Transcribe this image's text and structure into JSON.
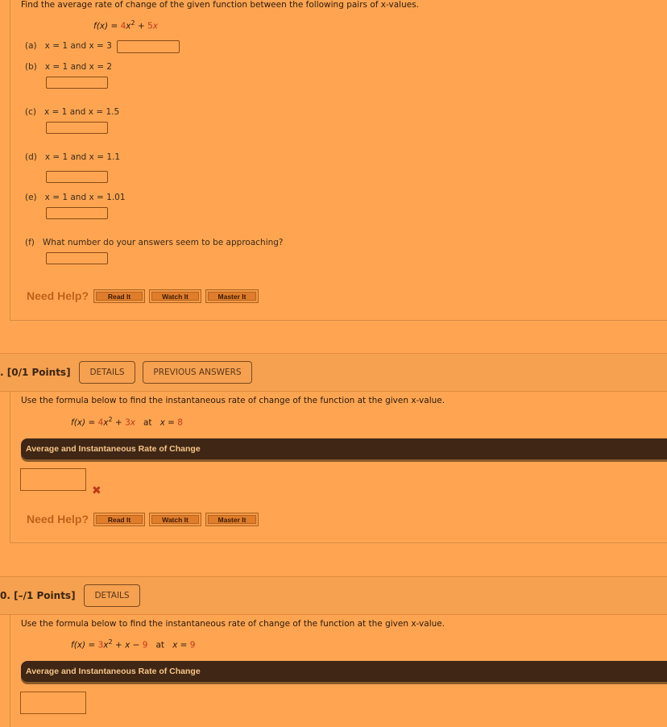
{
  "question8": {
    "prompt": "Find the average rate of change of the given function between the following pairs of x-values.",
    "formula": {
      "lhs": "f(x)",
      "eq": " = ",
      "c1": "4",
      "var1": "x",
      "exp": "2",
      "op": " + ",
      "c2": "5",
      "var2": "x"
    },
    "parts": [
      {
        "label": "(a)",
        "text": "x = 1 and x = 3",
        "value": ""
      },
      {
        "label": "(b)",
        "text": "x = 1 and x = 2",
        "value": ""
      },
      {
        "label": "(c)",
        "text": "x = 1 and x = 1.5",
        "value": ""
      },
      {
        "label": "(d)",
        "text": "x = 1 and x = 1.1",
        "value": ""
      },
      {
        "label": "(e)",
        "text": "x = 1 and x = 1.01",
        "value": ""
      },
      {
        "label": "(f)",
        "text": "What number do your answers seem to be approaching?",
        "value": ""
      }
    ],
    "need_help": "Need Help?",
    "help_buttons": [
      "Read It",
      "Watch It",
      "Master It"
    ]
  },
  "question9": {
    "number_fragment": ".",
    "points": "[0/1 Points]",
    "details_label": "DETAILS",
    "previous_answers_label": "PREVIOUS ANSWERS",
    "prompt": "Use the formula below to find the instantaneous rate of change of the function at the given x-value.",
    "formula": {
      "lhs": "f(x)",
      "eq": " = ",
      "c1": "4",
      "var1": "x",
      "exp": "2",
      "op": " + ",
      "c2": "3",
      "var2": "x",
      "at": "at",
      "xeq": "x = ",
      "xval": "8"
    },
    "banner": "Average and Instantaneous Rate of Change",
    "answer_value": "",
    "status_icon": "incorrect-x-icon",
    "status_glyph": "✖",
    "need_help": "Need Help?",
    "help_buttons": [
      "Read It",
      "Watch It",
      "Master It"
    ]
  },
  "question10": {
    "number_fragment": "0.",
    "points": "[–/1 Points]",
    "details_label": "DETAILS",
    "prompt": "Use the formula below to find the instantaneous rate of change of the function at the given x-value.",
    "formula": {
      "lhs": "f(x)",
      "eq": " = ",
      "c1": "3",
      "var1": "x",
      "exp": "2",
      "op1": " + ",
      "var2": "x",
      "op2": " − ",
      "c3": "9",
      "at": "at",
      "xeq": "x = ",
      "xval": "9"
    },
    "banner": "Average and Instantaneous Rate of Change",
    "answer_value": ""
  },
  "colors": {
    "page_bg": "#ffa552",
    "header_bg": "#f5a150",
    "banner_bg": "#3f2615",
    "accent_red": "#c0381a",
    "need_help": "#c0621a"
  }
}
